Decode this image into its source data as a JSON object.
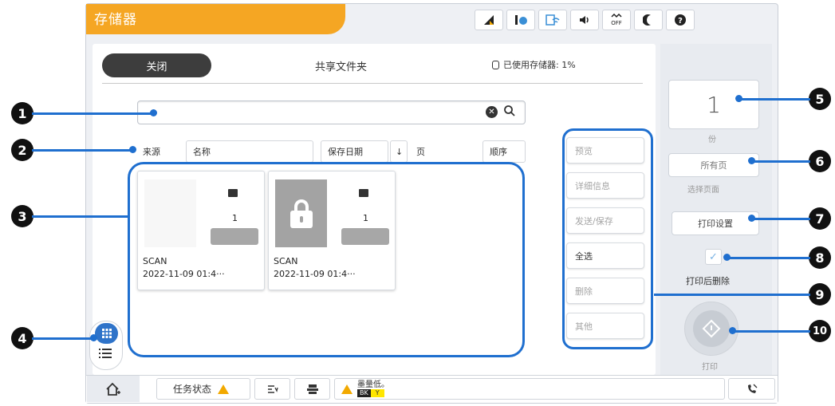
{
  "window": {
    "title": "存储器"
  },
  "header": {
    "close_label": "关闭",
    "title": "共享文件夹",
    "storage_used": "已使用存储器: 1%"
  },
  "status_icons": [
    "paper-icon",
    "ink-icon",
    "wifi-icon",
    "volume-icon",
    "wifi-direct-off-icon",
    "sleep-icon",
    "help-icon"
  ],
  "status_labels": {
    "wifi_direct": "OFF"
  },
  "search": {
    "placeholder": ""
  },
  "columns": {
    "source": "来源",
    "name": "名称",
    "date": "保存日期",
    "sort_arrow": "↓",
    "pages": "页",
    "order": "顺序"
  },
  "files": [
    {
      "pages": "1",
      "name": "SCAN",
      "date": "2022-11-09 01:4···",
      "locked": false
    },
    {
      "pages": "1",
      "name": "SCAN",
      "date": "2022-11-09 01:4···",
      "locked": true
    }
  ],
  "actions": {
    "preview": "预览",
    "details": "详细信息",
    "send_save": "发送/保存",
    "select_all": "全选",
    "delete": "删除",
    "other": "其他"
  },
  "print_panel": {
    "copies": "1",
    "copies_label": "份",
    "pages_value": "所有页",
    "pages_caption": "选择页面",
    "print_settings": "打印设置",
    "delete_after_print": "打印后删除",
    "delete_after_checked": true,
    "print_label": "打印"
  },
  "bottom": {
    "job_status": "任务状态",
    "ink_low": "墨量低。",
    "ink_k": "BK",
    "ink_y": "Y"
  },
  "callouts": [
    "1",
    "2",
    "3",
    "4",
    "5",
    "6",
    "7",
    "8",
    "9",
    "10"
  ],
  "colors": {
    "accent": "#f5a623",
    "callout_blue": "#1f6fcf",
    "selected_view": "#2e73c9"
  }
}
